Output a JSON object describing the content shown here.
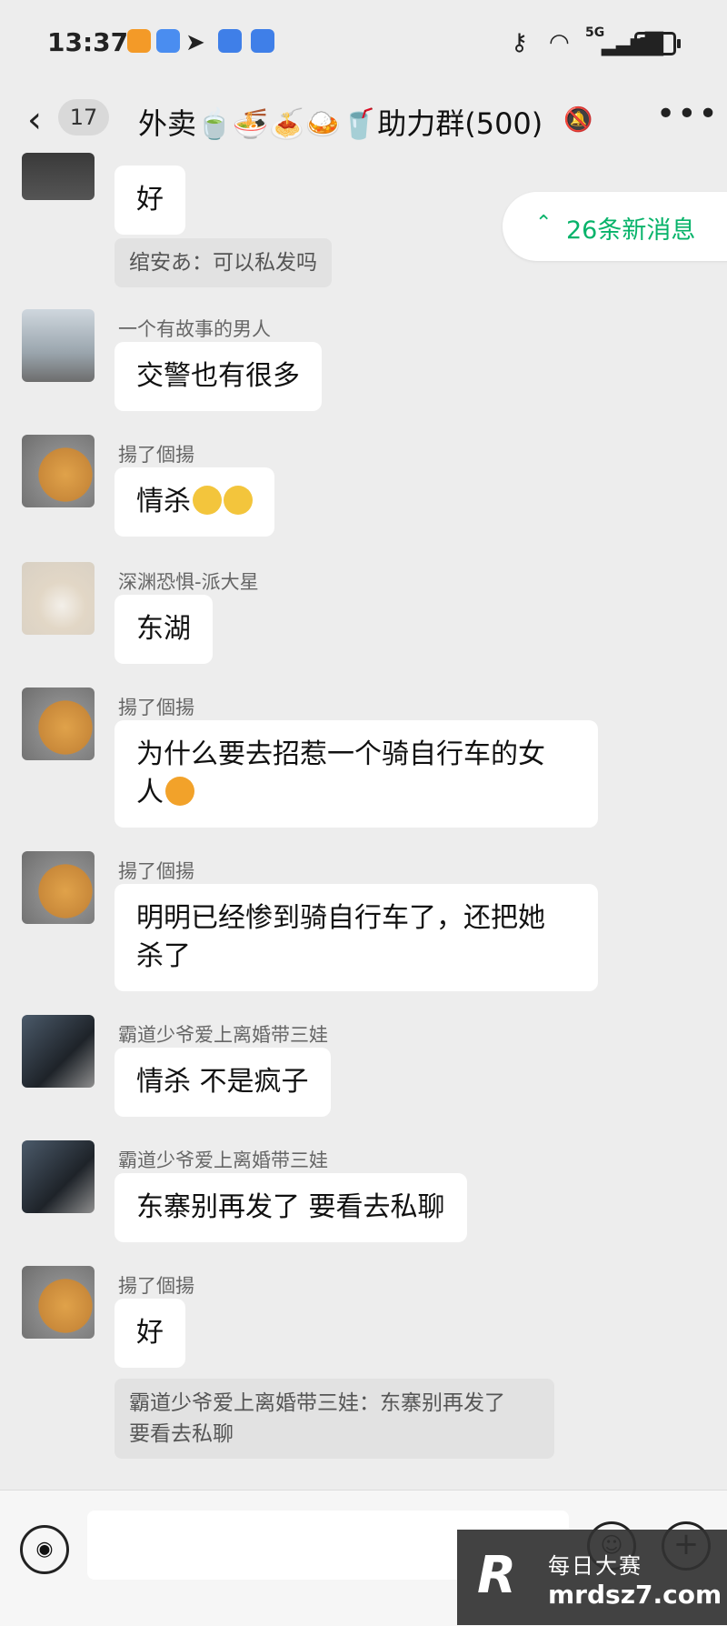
{
  "status": {
    "time": "13:37",
    "network": "5G"
  },
  "header": {
    "unread_count": "17",
    "title": "外卖🍵🍜🍝🍛🥤助力群(500)"
  },
  "new_messages": "26条新消息",
  "messages": [
    {
      "text": "好"
    },
    {
      "quote": "绾安あ：可以私发吗"
    },
    {
      "sender": "一个有故事的男人",
      "text": "交警也有很多"
    },
    {
      "sender": "揚了個揚",
      "text": "情杀"
    },
    {
      "sender": "深渊恐惧-派大星",
      "text": "东湖"
    },
    {
      "sender": "揚了個揚",
      "line1": "为什么要去招惹一个骑自行车的女",
      "line2": "人"
    },
    {
      "sender": "揚了個揚",
      "line1": "明明已经惨到骑自行车了，还把她",
      "line2": "杀了"
    },
    {
      "sender": "霸道少爷爱上离婚带三娃",
      "text": "情杀 不是疯子"
    },
    {
      "sender": "霸道少爷爱上离婚带三娃",
      "text": "东寨别再发了 要看去私聊"
    },
    {
      "sender": "揚了個揚",
      "text": "好"
    },
    {
      "quote_line1": "霸道少爷爱上离婚带三娃：东寨别再发了",
      "quote_line2": "要看去私聊"
    }
  ],
  "watermark": {
    "line1": "每日大赛",
    "line2": "mrdsz7.com"
  },
  "colors": {
    "accent": "#07b36a",
    "background": "#ededed",
    "bubble": "#ffffff"
  }
}
